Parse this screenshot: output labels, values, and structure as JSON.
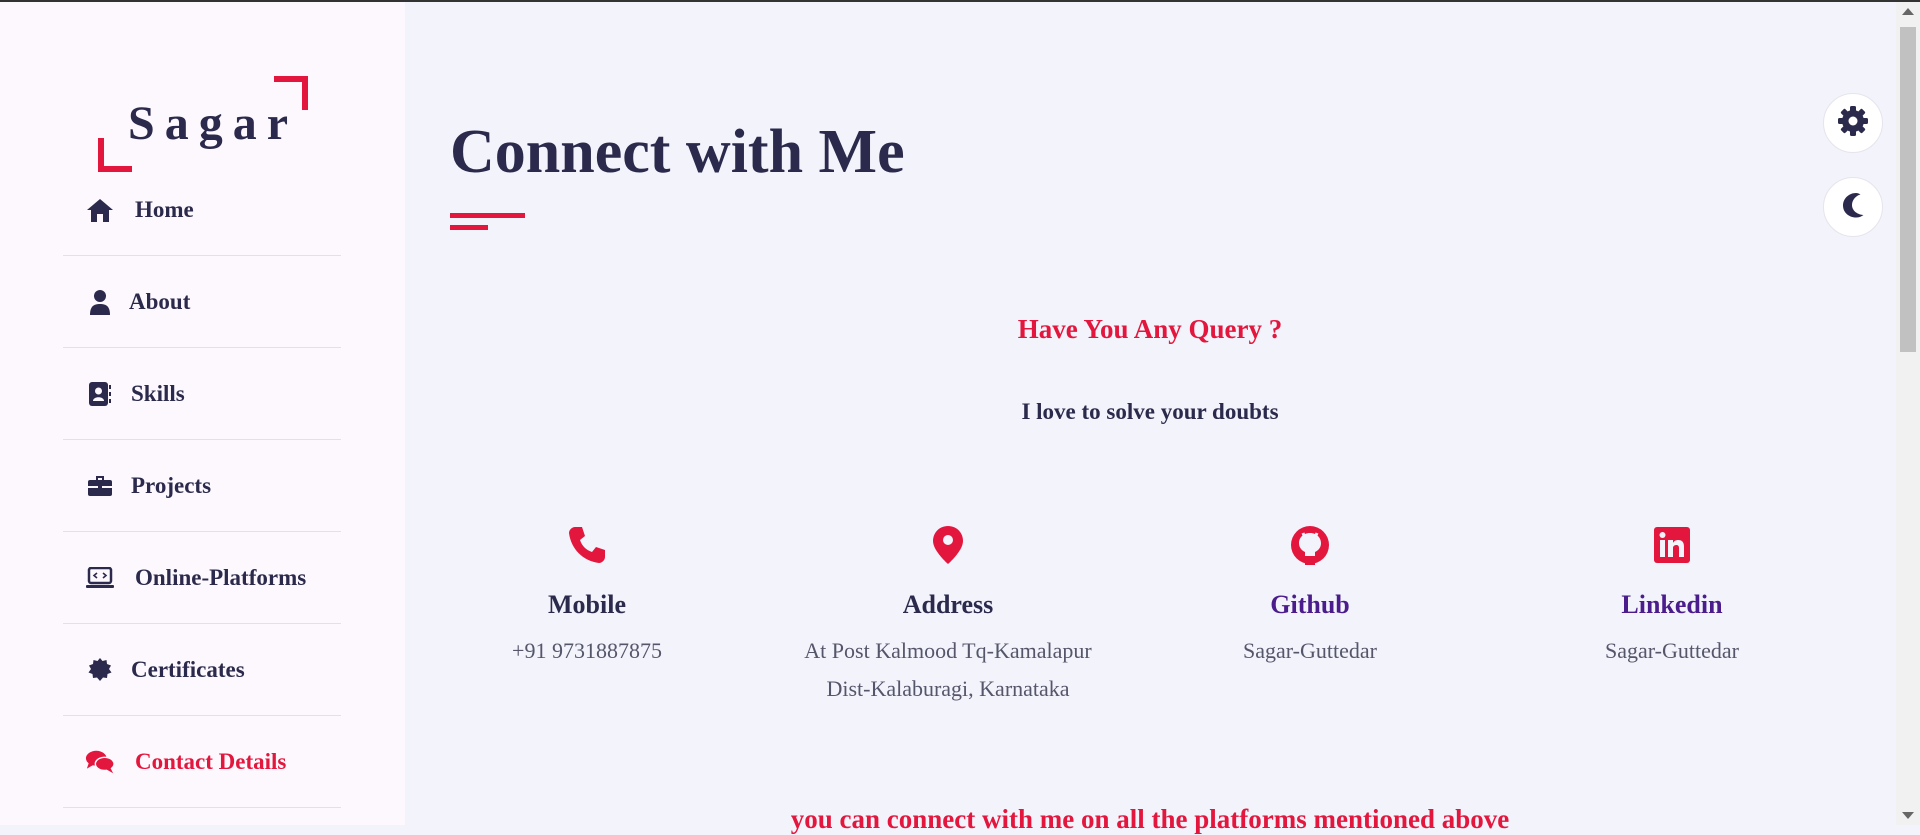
{
  "logo": {
    "text": "Sagar"
  },
  "sidebar": {
    "items": [
      {
        "label": "Home",
        "icon": "home-icon"
      },
      {
        "label": "About",
        "icon": "user-icon"
      },
      {
        "label": "Skills",
        "icon": "address-book-icon"
      },
      {
        "label": "Projects",
        "icon": "briefcase-icon"
      },
      {
        "label": "Online-Platforms",
        "icon": "laptop-code-icon"
      },
      {
        "label": "Certificates",
        "icon": "certificate-icon"
      },
      {
        "label": "Contact Details",
        "icon": "comments-icon",
        "active": true
      }
    ]
  },
  "main": {
    "title": "Connect with Me",
    "query": "Have You Any Query ?",
    "subtitle": "I love to solve your doubts",
    "cards": [
      {
        "icon": "phone-icon",
        "title": "Mobile",
        "lines": [
          "+91 9731887875"
        ]
      },
      {
        "icon": "map-marker-icon",
        "title": "Address",
        "lines": [
          "At Post Kalmood Tq-Kamalapur",
          "Dist-Kalaburagi, Karnataka"
        ]
      },
      {
        "icon": "github-icon",
        "title": "Github",
        "lines": [
          "Sagar-Guttedar"
        ]
      },
      {
        "icon": "linkedin-icon",
        "title": "Linkedin",
        "lines": [
          "Sagar-Guttedar"
        ]
      }
    ],
    "bottom_note": "you can connect with me on all the platforms mentioned above"
  },
  "controls": {
    "settings_icon": "gear-icon",
    "theme_icon": "moon-icon"
  },
  "colors": {
    "accent": "#e3173e",
    "text": "#2b2a4c",
    "link": "#4b1d8c",
    "sidebar_bg": "#fdf8fd",
    "main_bg": "#f2f3fb"
  }
}
